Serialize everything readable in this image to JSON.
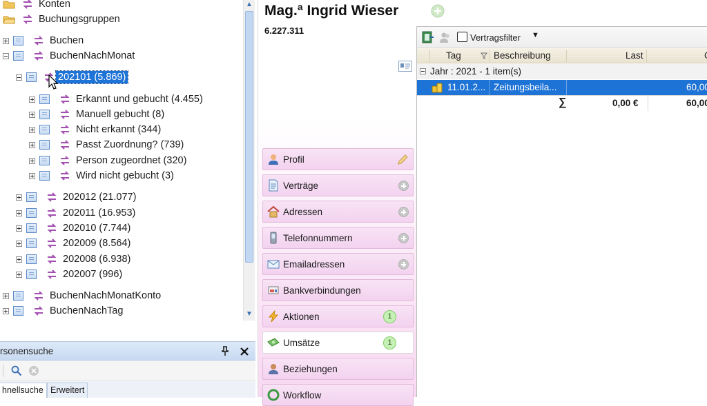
{
  "tree": {
    "items": [
      {
        "label": "Konten"
      },
      {
        "label": "Buchungsgruppen"
      },
      {
        "label": "Buchen"
      },
      {
        "label": "BuchenNachMonat"
      },
      {
        "label": "202101 (5.869)"
      },
      {
        "label": "Erkannt und gebucht (4.455)"
      },
      {
        "label": "Manuell gebucht (8)"
      },
      {
        "label": "Nicht erkannt (344)"
      },
      {
        "label": "Passt Zuordnung? (739)"
      },
      {
        "label": "Person zugeordnet (320)"
      },
      {
        "label": "Wird nicht gebucht (3)"
      },
      {
        "label": "202012 (21.077)"
      },
      {
        "label": "202011 (16.953)"
      },
      {
        "label": "202010 (7.744)"
      },
      {
        "label": "202009 (8.564)"
      },
      {
        "label": "202008 (6.938)"
      },
      {
        "label": "202007 (996)"
      },
      {
        "label": "BuchenNachMonatKonto"
      },
      {
        "label": "BuchenNachTag"
      }
    ]
  },
  "search_panel": {
    "title": "rsonensuche",
    "tabs": [
      "hnellsuche",
      "Erweitert"
    ]
  },
  "person": {
    "name": "Mag.ª Ingrid Wieser",
    "id": "6.227.311"
  },
  "nav": {
    "items": [
      {
        "label": "Profil",
        "icon": "person-icon"
      },
      {
        "label": "Verträge",
        "icon": "document-icon"
      },
      {
        "label": "Adressen",
        "icon": "house-icon"
      },
      {
        "label": "Telefonnummern",
        "icon": "phone-icon"
      },
      {
        "label": "Emailadressen",
        "icon": "envelope-icon"
      },
      {
        "label": "Bankverbindungen",
        "icon": "bank-icon"
      },
      {
        "label": "Aktionen",
        "icon": "lightning-icon",
        "count": "1"
      },
      {
        "label": "Umsätze",
        "icon": "money-icon",
        "count": "1"
      },
      {
        "label": "Beziehungen",
        "icon": "people-icon"
      },
      {
        "label": "Workflow",
        "icon": "workflow-icon"
      }
    ]
  },
  "list": {
    "filter_label": "Vertragsfilter",
    "columns": [
      "Tag",
      "Beschreibung",
      "Last",
      "G"
    ],
    "group_label": "Jahr : 2021 - 1 item(s)",
    "row": {
      "tag": "11.01.2...",
      "beschreibung": "Zeitungsbeila...",
      "amount": "60,00"
    },
    "sum": {
      "symbol": "∑",
      "last": "0,00 €",
      "other": "60,00"
    }
  },
  "colors": {
    "selection": "#1e73d6",
    "nav_pink": "#f3d2ef",
    "badge_green": "#c6f0b6"
  }
}
